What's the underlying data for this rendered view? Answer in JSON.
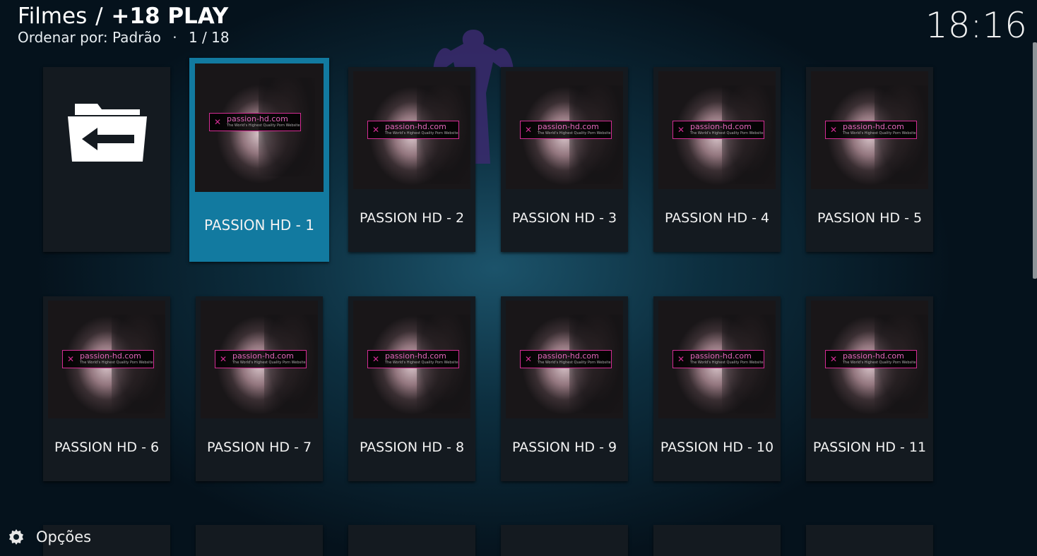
{
  "header": {
    "section": "Filmes",
    "separator": "/",
    "addon": "+18 PLAY",
    "sort_label": "Ordenar por: Padrão",
    "dot": "·",
    "position": "1 / 18"
  },
  "clock": "18:16",
  "options_label": "Opções",
  "tiles": [
    {
      "label": ""
    },
    {
      "label": "PASSION HD - 1"
    },
    {
      "label": "PASSION HD - 2"
    },
    {
      "label": "PASSION HD - 3"
    },
    {
      "label": "PASSION HD - 4"
    },
    {
      "label": "PASSION HD - 5"
    },
    {
      "label": "PASSION HD - 6"
    },
    {
      "label": "PASSION HD - 7"
    },
    {
      "label": "PASSION HD - 8"
    },
    {
      "label": "PASSION HD - 9"
    },
    {
      "label": "PASSION HD - 10"
    },
    {
      "label": "PASSION HD - 11"
    }
  ],
  "thumb_banner": {
    "title": "passion-hd.com",
    "subtitle": "The World's Highest Quality Porn Website"
  },
  "colors": {
    "focus": "#127aa0",
    "tile": "#141a20",
    "banner_accent": "#d42c94"
  },
  "icons": {
    "back": "folder-back-icon",
    "options": "gear-icon"
  }
}
